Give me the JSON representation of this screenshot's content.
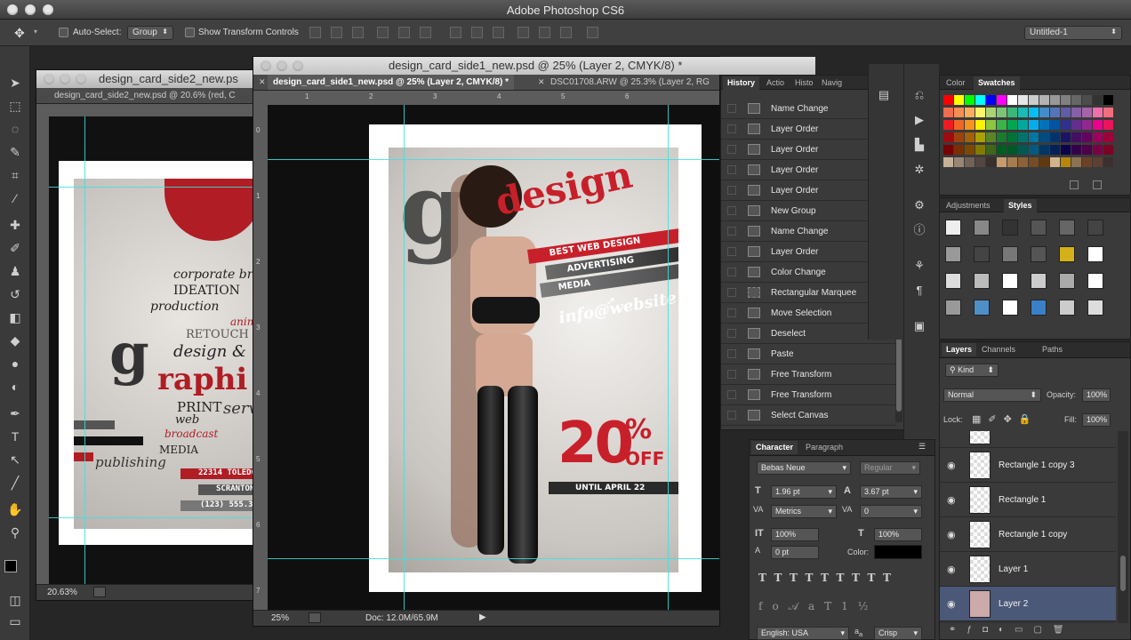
{
  "app": {
    "title": "Adobe Photoshop CS6"
  },
  "options": {
    "auto_select_label": "Auto-Select:",
    "auto_select_value": "Group",
    "show_transform_label": "Show Transform Controls",
    "workspace_value": "Untitled-1"
  },
  "doc_back": {
    "window_title": "design_card_side2_new.ps",
    "tab_label": "design_card_side2_new.psd @ 20.6% (red, C",
    "zoom": "20.63%",
    "poster_text": {
      "line1": "corporate br",
      "line2": "IDEATION",
      "line3": "production",
      "line4": "animat",
      "line5": "RETOUCH",
      "line6": "design &",
      "line7": "raphi",
      "line8": "PRINT",
      "line9": "servi",
      "line10": "web",
      "line11": "broadcast",
      "line12": "MEDIA",
      "line13": "publishing",
      "addr1": "22314 TOLEDO",
      "addr2": "SCRANTON",
      "addr3": "(123) 555.34"
    }
  },
  "doc_front": {
    "window_title": "design_card_side1_new.psd @ 25% (Layer 2, CMYK/8) *",
    "tab_active": "design_card_side1_new.psd @ 25% (Layer 2, CMYK/8) *",
    "tab_other": "DSC01708.ARW @ 25.3% (Layer 2, RG",
    "zoom": "25%",
    "doc_size": "Doc: 12.0M/65.9M",
    "poster": {
      "headline": "design",
      "band1": "BEST WEB DESIGN",
      "band2": "ADVERTISING",
      "band3": "MEDIA",
      "contact": "info@website",
      "offer_big": "20",
      "offer_pct": "%",
      "offer_off": "OFF",
      "until": "UNTIL APRIL 22"
    },
    "ruler_h": [
      "1",
      "2",
      "3",
      "4",
      "5",
      "6"
    ],
    "ruler_v": [
      "0",
      "1",
      "2",
      "3",
      "4",
      "5",
      "6",
      "7"
    ]
  },
  "history": {
    "tabs": [
      "History",
      "Actio",
      "Histo",
      "Navig"
    ],
    "items": [
      "Name Change",
      "Layer Order",
      "Layer Order",
      "Layer Order",
      "Layer Order",
      "New Group",
      "Name Change",
      "Layer Order",
      "Color Change",
      "Rectangular Marquee",
      "Move Selection",
      "Deselect",
      "Paste",
      "Free Transform",
      "Free Transform",
      "Select Canvas"
    ]
  },
  "character": {
    "tabs": [
      "Character",
      "Paragraph"
    ],
    "font": "Bebas Neue",
    "style": "Regular",
    "size": "1.96 pt",
    "leading": "3.67 pt",
    "kerning": "Metrics",
    "tracking": "0",
    "vscale": "100%",
    "hscale": "100%",
    "baseline": "0 pt",
    "color_label": "Color:",
    "language": "English: USA",
    "antialias": "Crisp"
  },
  "color_panel": {
    "tabs": [
      "Color",
      "Swatches"
    ]
  },
  "adjust_panel": {
    "tabs": [
      "Adjustments",
      "Styles"
    ]
  },
  "layers": {
    "tabs": [
      "Layers",
      "Channels",
      "Paths"
    ],
    "filter": "Kind",
    "blend": "Normal",
    "opacity_label": "Opacity:",
    "opacity": "100%",
    "lock_label": "Lock:",
    "fill_label": "Fill:",
    "fill": "100%",
    "items": [
      "Rectangle 1 copy 3",
      "Rectangle 1",
      "Rectangle 1 copy",
      "Layer 1",
      "Layer 2"
    ]
  },
  "colors": {
    "accent_red": "#c8202a",
    "guide": "#3ee0e0",
    "selected_layer": "#4b5878"
  }
}
